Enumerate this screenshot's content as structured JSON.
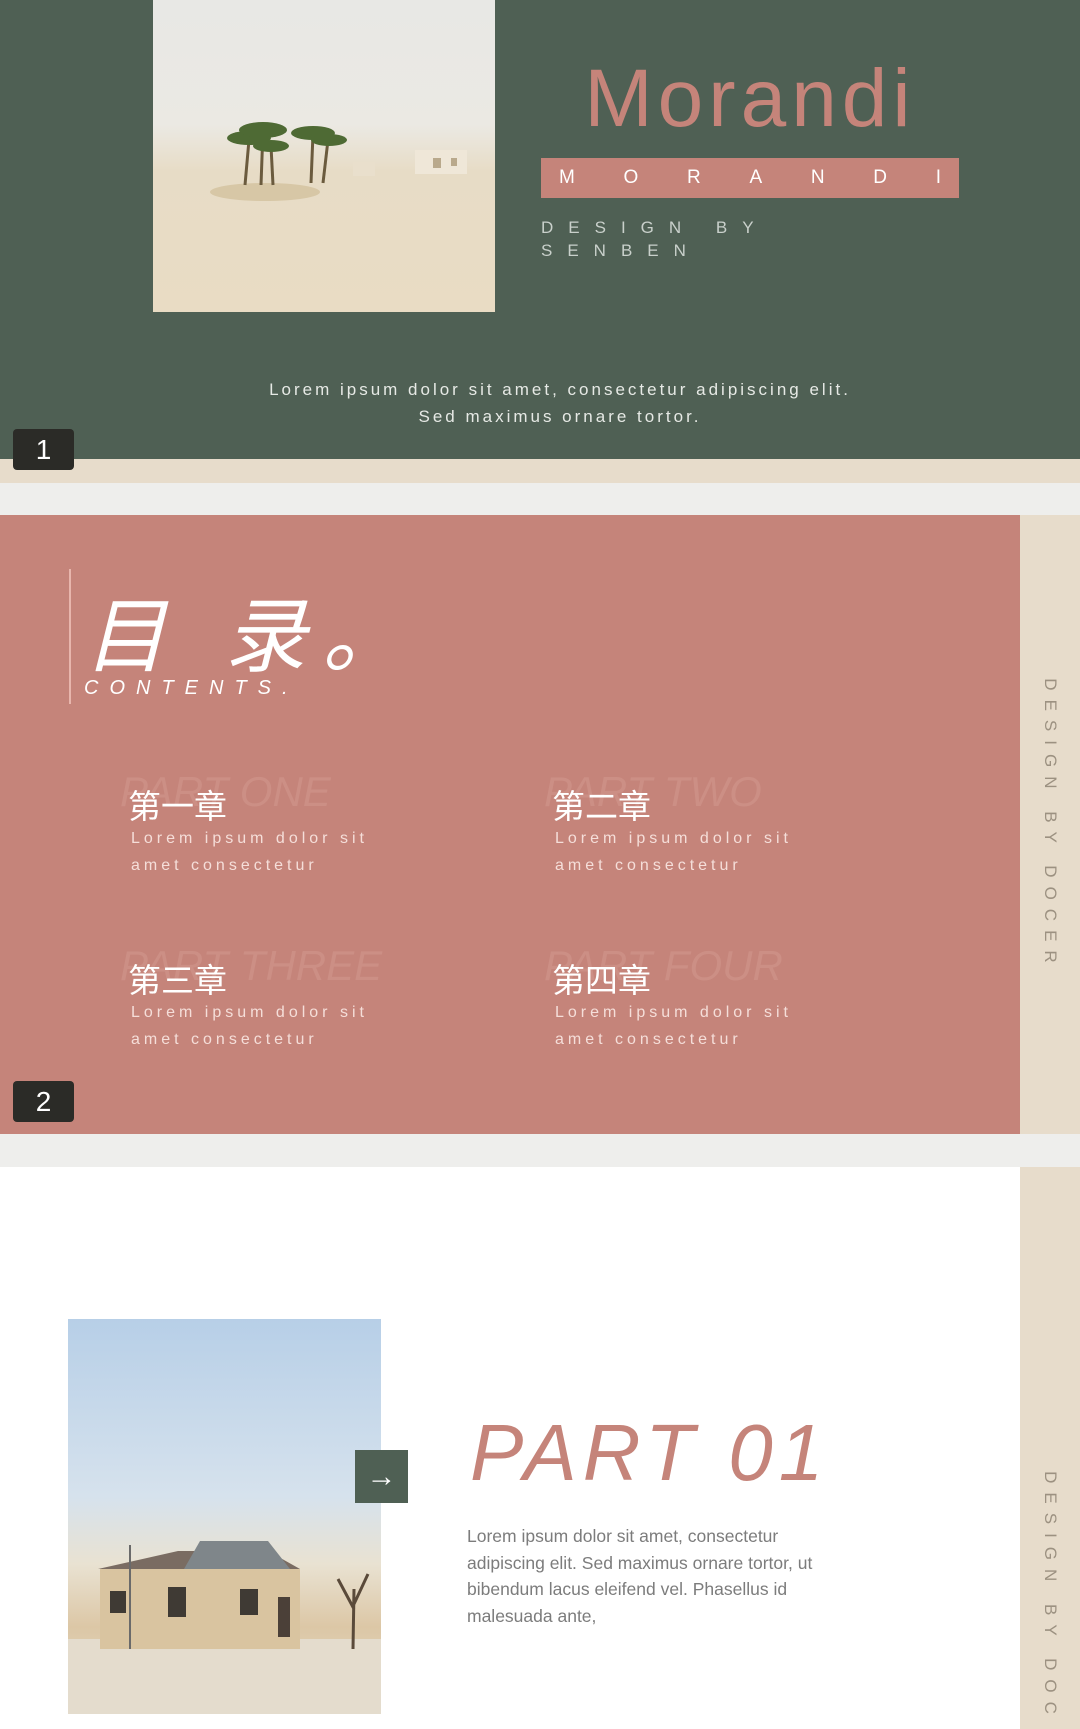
{
  "slides": [
    {
      "number": "1",
      "title": "Morandi",
      "band_letters": [
        "M",
        "O",
        "R",
        "A",
        "N",
        "D",
        "I"
      ],
      "design_by_line1": "DESIGN BY",
      "design_by_line2": "SENBEN",
      "tagline_line1": "Lorem ipsum dolor sit amet, consectetur adipiscing elit.",
      "tagline_line2": "Sed maximus ornare tortor."
    },
    {
      "number": "2",
      "title": "目 录。",
      "subtitle": "CONTENTS.",
      "side_text": "DESIGN BY DOCER",
      "items": [
        {
          "ghost": "PART ONE",
          "heading": "第一章",
          "desc_line1": "Lorem ipsum dolor sit",
          "desc_line2": "amet consectetur"
        },
        {
          "ghost": "PART TWO",
          "heading": "第二章",
          "desc_line1": "Lorem ipsum dolor sit",
          "desc_line2": "amet consectetur"
        },
        {
          "ghost": "PART THREE",
          "heading": "第三章",
          "desc_line1": "Lorem ipsum dolor sit",
          "desc_line2": "amet consectetur"
        },
        {
          "ghost": "PART FOUR",
          "heading": "第四章",
          "desc_line1": "Lorem ipsum dolor sit",
          "desc_line2": "amet consectetur"
        }
      ]
    },
    {
      "title": "PART 01",
      "arrow": "→",
      "body": "Lorem ipsum dolor sit amet, consectetur adipiscing elit. Sed maximus ornare tortor, ut bibendum lacus eleifend vel. Phasellus id malesuada ante,",
      "side_text": "DESIGN BY DOC"
    }
  ],
  "colors": {
    "green": "#4f6054",
    "rose": "#c5847a",
    "beige": "#e7dccb",
    "badge": "#2b2b27"
  }
}
